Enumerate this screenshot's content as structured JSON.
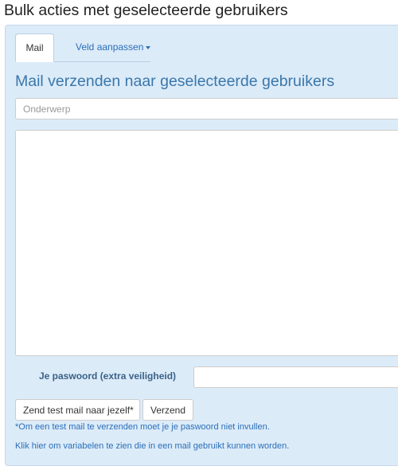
{
  "page": {
    "title": "Bulk acties met geselecteerde gebruikers"
  },
  "tabs": [
    {
      "label": "Mail",
      "active": true
    },
    {
      "label": "Veld aanpassen",
      "active": false,
      "has_dropdown": true
    }
  ],
  "mail_form": {
    "heading": "Mail verzenden naar geselecteerde gebruikers",
    "subject_placeholder": "Onderwerp",
    "subject_value": "",
    "body_value": "",
    "password_label": "Je paswoord (extra veiligheid)",
    "password_value": "",
    "test_button_label": "Zend test mail naar jezelf*",
    "send_button_label": "Verzend",
    "test_note": "*Om een test mail te verzenden moet je je paswoord niet invullen.",
    "variables_link": "Klik hier om variabelen te zien die in een mail gebruikt kunnen worden."
  },
  "colors": {
    "panel_background": "#dcebf8",
    "heading": "#3a77ab",
    "link": "#2a6fb8",
    "label": "#3a6289"
  }
}
